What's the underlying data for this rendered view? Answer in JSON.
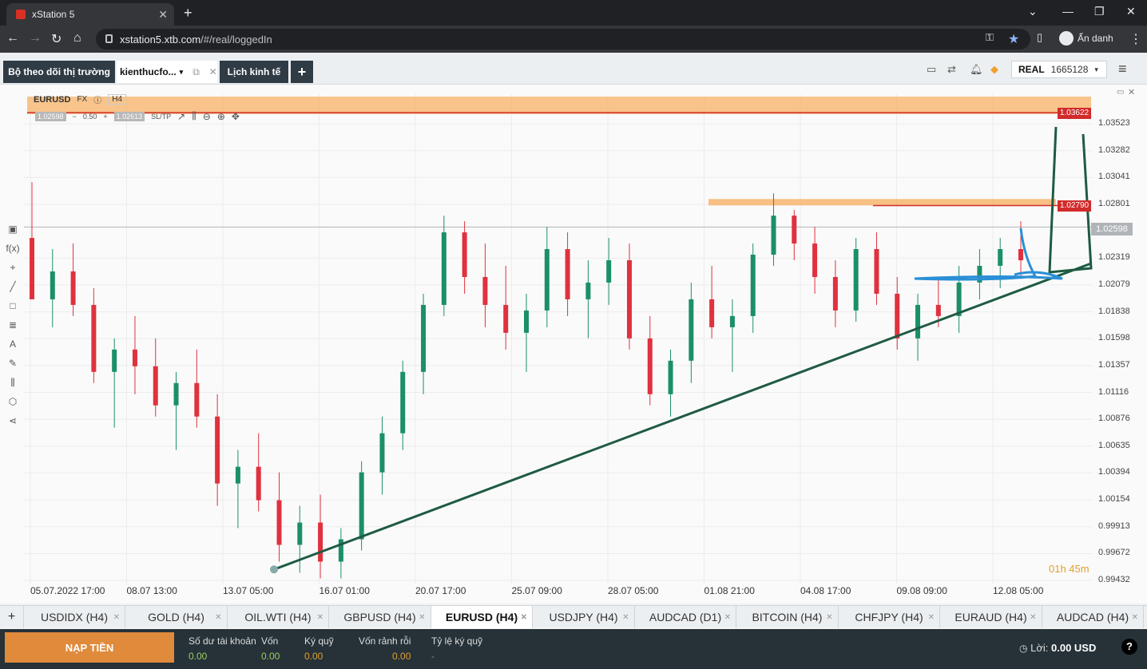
{
  "browser": {
    "tab_title": "xStation 5",
    "url_host": "xstation5.xtb.com",
    "url_path": "/#/real/loggedIn",
    "profile_label": "Ẩn danh"
  },
  "app_tabs": {
    "watchlist": "Bộ theo dõi thị trường",
    "kienthuc": "kienthucfo...",
    "calendar": "Lịch kinh tế",
    "add": "+"
  },
  "account": {
    "mode": "REAL",
    "number": "1665128"
  },
  "chart_header": {
    "symbol": "EURUSD",
    "market": "FX",
    "timeframe": "H4",
    "bid": "1.02598",
    "lot": "0.50",
    "ask": "1.02613",
    "sltp": "SL/TP"
  },
  "chart_data": {
    "type": "candlestick",
    "symbol": "EURUSD",
    "timeframe": "H4",
    "y_ticks": [
      "1.03523",
      "1.03282",
      "1.03041",
      "1.02801",
      "1.02319",
      "1.02079",
      "1.01838",
      "1.01598",
      "1.01357",
      "1.01116",
      "1.00876",
      "1.00635",
      "1.00394",
      "1.00154",
      "0.99913",
      "0.99672",
      "0.99432"
    ],
    "x_ticks": [
      "05.07.2022 17:00",
      "08.07 13:00",
      "13.07 05:00",
      "16.07 01:00",
      "20.07 17:00",
      "25.07 09:00",
      "28.07 05:00",
      "01.08 21:00",
      "04.08 17:00",
      "09.08 09:00",
      "12.08 05:00"
    ],
    "current_price": "1.02598",
    "resistance_high": "1.03622",
    "resistance_mid": "1.02790",
    "countdown": "01h 45m",
    "trendline_from": {
      "date": "13.07 05:00",
      "price": 0.9953
    },
    "trendline_to": {
      "date": "12.08 05:00",
      "price": 1.0225
    },
    "candles": [
      [
        1.025,
        1.03,
        1.023,
        1.0195
      ],
      [
        1.0195,
        1.024,
        1.017,
        1.022
      ],
      [
        1.022,
        1.0245,
        1.018,
        1.019
      ],
      [
        1.019,
        1.0205,
        1.012,
        1.013
      ],
      [
        1.013,
        1.016,
        1.008,
        1.015
      ],
      [
        1.015,
        1.018,
        1.011,
        1.0135
      ],
      [
        1.0135,
        1.016,
        1.009,
        1.01
      ],
      [
        1.01,
        1.013,
        1.006,
        1.012
      ],
      [
        1.012,
        1.015,
        1.008,
        1.009
      ],
      [
        1.009,
        1.011,
        1.001,
        1.003
      ],
      [
        1.003,
        1.006,
        0.999,
        1.0045
      ],
      [
        1.0045,
        1.0075,
        1.0005,
        1.0015
      ],
      [
        1.0015,
        1.004,
        0.996,
        0.9975
      ],
      [
        0.9975,
        1.001,
        0.995,
        0.9995
      ],
      [
        0.9995,
        1.002,
        0.9945,
        0.996
      ],
      [
        0.996,
        0.999,
        0.9945,
        0.998
      ],
      [
        0.998,
        1.005,
        0.997,
        1.004
      ],
      [
        1.004,
        1.009,
        1.002,
        1.0075
      ],
      [
        1.0075,
        1.014,
        1.006,
        1.013
      ],
      [
        1.013,
        1.02,
        1.011,
        1.019
      ],
      [
        1.019,
        1.027,
        1.018,
        1.0255
      ],
      [
        1.0255,
        1.0265,
        1.02,
        1.0215
      ],
      [
        1.0215,
        1.0245,
        1.017,
        1.019
      ],
      [
        1.019,
        1.0225,
        1.015,
        1.0165
      ],
      [
        1.0165,
        1.02,
        1.013,
        1.0185
      ],
      [
        1.0185,
        1.026,
        1.017,
        1.024
      ],
      [
        1.024,
        1.0255,
        1.018,
        1.0195
      ],
      [
        1.0195,
        1.023,
        1.016,
        1.021
      ],
      [
        1.021,
        1.025,
        1.019,
        1.023
      ],
      [
        1.023,
        1.0245,
        1.015,
        1.016
      ],
      [
        1.016,
        1.018,
        1.01,
        1.011
      ],
      [
        1.011,
        1.015,
        1.009,
        1.014
      ],
      [
        1.014,
        1.021,
        1.012,
        1.0195
      ],
      [
        1.0195,
        1.0225,
        1.016,
        1.017
      ],
      [
        1.017,
        1.0195,
        1.013,
        1.018
      ],
      [
        1.018,
        1.0245,
        1.0165,
        1.0235
      ],
      [
        1.0235,
        1.029,
        1.0225,
        1.027
      ],
      [
        1.027,
        1.0275,
        1.023,
        1.0245
      ],
      [
        1.0245,
        1.026,
        1.02,
        1.0215
      ],
      [
        1.0215,
        1.023,
        1.017,
        1.0185
      ],
      [
        1.0185,
        1.025,
        1.0175,
        1.024
      ],
      [
        1.024,
        1.0255,
        1.019,
        1.02
      ],
      [
        1.02,
        1.0215,
        1.015,
        1.016
      ],
      [
        1.016,
        1.02,
        1.014,
        1.019
      ],
      [
        1.019,
        1.0215,
        1.017,
        1.018
      ],
      [
        1.018,
        1.0225,
        1.0165,
        1.021
      ],
      [
        1.021,
        1.024,
        1.0195,
        1.0225
      ],
      [
        1.0225,
        1.025,
        1.0205,
        1.024
      ],
      [
        1.024,
        1.0265,
        1.0215,
        1.023
      ]
    ]
  },
  "bottom_tabs": [
    "USDIDX (H4)",
    "GOLD (H4)",
    "OIL.WTI (H4)",
    "GBPUSD (H4)",
    "EURUSD (H4)",
    "USDJPY (H4)",
    "AUDCAD (D1)",
    "BITCOIN (H4)",
    "CHFJPY (H4)",
    "EURAUD (H4)",
    "AUDCAD (H4)"
  ],
  "footer": {
    "deposit": "NẠP TIỀN",
    "balance_label": "Số dư tài khoản",
    "balance": "0.00",
    "capital_label": "Vốn",
    "capital": "0.00",
    "margin_label": "Ký quỹ",
    "margin": "0.00",
    "free_label": "Vốn rảnh rỗi",
    "free": "0.00",
    "ratio_label": "Tỷ lệ ký quỹ",
    "ratio": "-",
    "profit_label": "Lời:",
    "profit": "0.00 USD"
  },
  "colors": {
    "up": "#1b8f6a",
    "down": "#e0313e",
    "trend": "#1e5b42",
    "blue": "#2a8fd6",
    "orange": "#f7b267"
  }
}
